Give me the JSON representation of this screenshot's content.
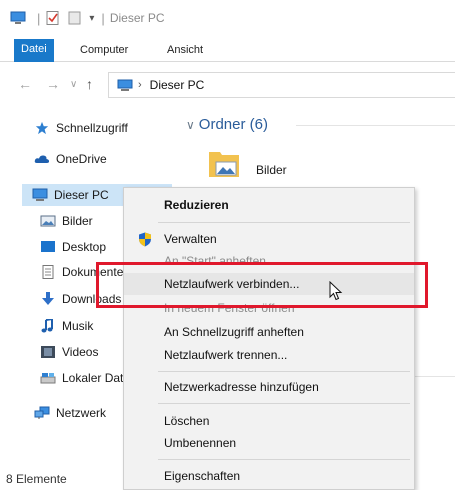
{
  "window": {
    "title": "Dieser PC"
  },
  "ribbon": {
    "tabs": [
      {
        "label": "Datei",
        "active": true
      },
      {
        "label": "Computer",
        "active": false
      },
      {
        "label": "Ansicht",
        "active": false
      }
    ]
  },
  "address": {
    "path": "Dieser PC"
  },
  "sidebar": {
    "items": [
      {
        "label": "Schnellzugriff",
        "icon": "star-icon"
      },
      {
        "label": "OneDrive",
        "icon": "cloud-icon"
      },
      {
        "label": "Dieser PC",
        "icon": "computer-icon",
        "selected": true
      },
      {
        "label": "Bilder",
        "icon": "pictures-icon"
      },
      {
        "label": "Desktop",
        "icon": "desktop-icon"
      },
      {
        "label": "Dokumente",
        "icon": "documents-icon"
      },
      {
        "label": "Downloads",
        "icon": "download-icon"
      },
      {
        "label": "Musik",
        "icon": "music-icon"
      },
      {
        "label": "Videos",
        "icon": "videos-icon"
      },
      {
        "label": "Lokaler Dat",
        "icon": "drive-icon"
      },
      {
        "label": "Netzwerk",
        "icon": "network-icon"
      }
    ]
  },
  "status": {
    "count": "8 Elemente"
  },
  "content": {
    "group_header": "Ordner (6)",
    "folders": [
      {
        "label": "Bilder",
        "icon": "folder-pictures-icon"
      }
    ]
  },
  "context_menu": {
    "items": [
      {
        "label": "Reduzieren",
        "bold": true
      },
      {
        "label": "Verwalten",
        "icon": "shield-icon"
      },
      {
        "label": "An \"Start\" anheften",
        "faded": true
      },
      {
        "label": "Netzlaufwerk verbinden...",
        "hover": true
      },
      {
        "label": "In neuem Fenster öffnen",
        "faded": true
      },
      {
        "label": "An Schnellzugriff anheften"
      },
      {
        "label": "Netzlaufwerk trennen..."
      },
      {
        "label": "Netzwerkadresse hinzufügen"
      },
      {
        "label": "Löschen"
      },
      {
        "label": "Umbenennen"
      },
      {
        "label": "Eigenschaften"
      }
    ]
  },
  "colors": {
    "accent": "#1979ca",
    "selected_bg": "#cce4f7",
    "highlight_border": "#e0182c",
    "menu_bg": "#f2f2f2"
  }
}
